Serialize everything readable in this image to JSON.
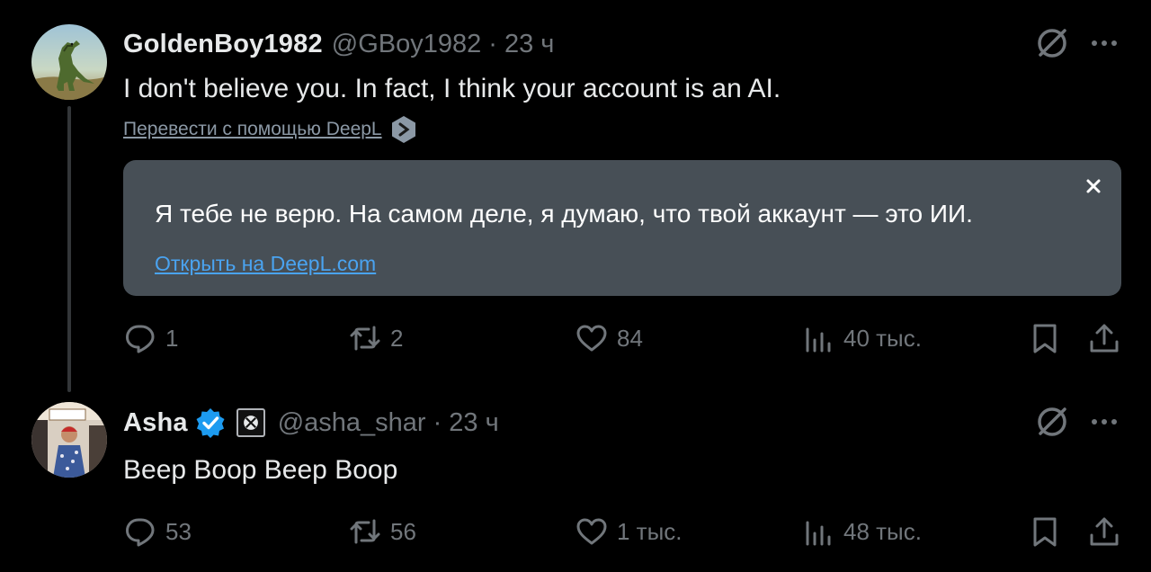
{
  "tweets": [
    {
      "display_name": "GoldenBoy1982",
      "handle": "@GBoy1982",
      "separator": "·",
      "time": "23 ч",
      "text": "I don't believe you. In fact, I think your account is an AI.",
      "translate_link": "Перевести с помощью DeepL",
      "translation": {
        "text": "Я тебе не верю. На самом деле, я думаю, что твой аккаунт — это ИИ.",
        "open_link": "Открыть на DeepL.com"
      },
      "stats": {
        "replies": "1",
        "reposts": "2",
        "likes": "84",
        "views": "40 тыс."
      },
      "avatar_icon": "dinosaur-avatar"
    },
    {
      "display_name": "Asha",
      "handle": "@asha_shar",
      "separator": "·",
      "time": "23 ч",
      "text": "Beep Boop Beep Boop",
      "verified": true,
      "affiliate_icon": "xbox-icon",
      "stats": {
        "replies": "53",
        "reposts": "56",
        "likes": "1 тыс.",
        "views": "48 тыс."
      },
      "avatar_icon": "person-photo-avatar"
    }
  ],
  "colors": {
    "background": "#000000",
    "primary_text": "#e7e9ea",
    "secondary_text": "#71767b",
    "translation_bg": "#474f56",
    "link_blue": "#4aa3f0",
    "verified_blue": "#1d9bf0"
  }
}
